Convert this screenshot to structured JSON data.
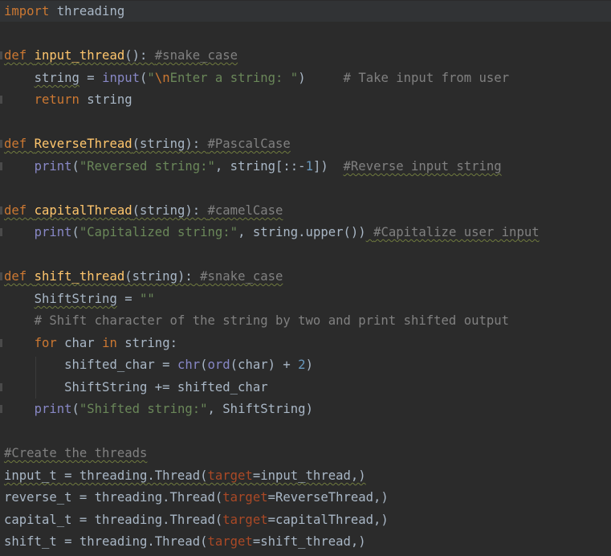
{
  "code": {
    "l1": {
      "kw": "import",
      "mod": " threading"
    },
    "l2": {
      "kw": "def ",
      "fn": "input_thread",
      "paren": "():",
      "sp": " ",
      "cm": "#snake_case"
    },
    "l3": {
      "ind": "    ",
      "var": "string",
      "eq": " = ",
      "bi": "input",
      "p1": "(",
      "s1": "\"",
      "esc": "\\n",
      "s2": "Enter a string: \"",
      "p2": ")",
      "sp": "     ",
      "cm": "# Take input from user"
    },
    "l4": {
      "ind": "    ",
      "kw": "return",
      "rest": " string"
    },
    "l5": {
      "kw": "def ",
      "fn": "ReverseThread",
      "paren": "(string):",
      "sp": " ",
      "cm": "#PascalCase"
    },
    "l6": {
      "ind": "    ",
      "bi": "print",
      "p1": "(",
      "s1": "\"Reversed string:\"",
      "rest": ", string[::-",
      "num": "1",
      "p2": "])",
      "sp": "  ",
      "cm": "#Reverse input string"
    },
    "l7": {
      "kw": "def ",
      "fn": "capitalThread",
      "paren": "(string):",
      "sp": " ",
      "cm": "#camelCase"
    },
    "l8": {
      "ind": "    ",
      "bi": "print",
      "p1": "(",
      "s1": "\"Capitalized string:\"",
      "rest": ", string.upper())",
      "sp": " ",
      "cm": "#Capitalize user input"
    },
    "l9": {
      "kw": "def ",
      "fn": "shift_thread",
      "paren": "(string):",
      "sp": " ",
      "cm": "#snake_case"
    },
    "l10": {
      "ind": "    ",
      "var": "ShiftString",
      "eq": " = ",
      "s1": "\"\""
    },
    "l11": {
      "ind": "    ",
      "cm": "# Shift character of the string by two and print shifted output"
    },
    "l12": {
      "ind": "    ",
      "kw1": "for",
      "mid": " char ",
      "kw2": "in",
      "rest": " string:"
    },
    "l13": {
      "ind": "        ",
      "a": "shifted_char = ",
      "bi1": "chr",
      "p1": "(",
      "bi2": "ord",
      "b": "(char) + ",
      "num": "2",
      "c": ")"
    },
    "l14": {
      "ind": "        ",
      "a": "ShiftString += shifted_char"
    },
    "l15": {
      "ind": "    ",
      "bi": "print",
      "p1": "(",
      "s1": "\"Shifted string:\"",
      "rest": ", ShiftString)"
    },
    "l16": {
      "cm": "#Create the threads"
    },
    "l17": {
      "a": "input_t = threading.Thread(",
      "param": "target",
      "b": "=input_thread,)"
    },
    "l18": {
      "a": "reverse_t = threading.Thread(",
      "param": "target",
      "b": "=ReverseThread,)"
    },
    "l19": {
      "a": "capital_t = threading.Thread(",
      "param": "target",
      "b": "=capitalThread,)"
    },
    "l20": {
      "a": "shift_t = threading.Thread(",
      "param": "target",
      "b": "=shift_thread,)"
    }
  },
  "colors": {
    "background": "#2b2b2b",
    "keyword": "#cc7832",
    "function": "#ffc66d",
    "string": "#6a8759",
    "comment": "#808080",
    "builtin": "#8888c6",
    "number": "#6897bb",
    "parameter": "#aa4926"
  }
}
